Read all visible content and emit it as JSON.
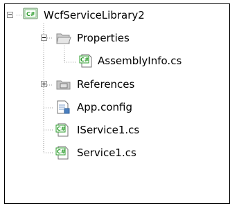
{
  "tree": {
    "nodes": [
      {
        "label": "WcfServiceLibrary2",
        "icon": "csharp-project-icon",
        "expanded": true
      },
      {
        "label": "Properties",
        "icon": "folder-icon",
        "expanded": true
      },
      {
        "label": "AssemblyInfo.cs",
        "icon": "csharp-file-icon"
      },
      {
        "label": "References",
        "icon": "references-icon",
        "expanded": false
      },
      {
        "label": "App.config",
        "icon": "config-file-icon"
      },
      {
        "label": "IService1.cs",
        "icon": "csharp-file-icon"
      },
      {
        "label": "Service1.cs",
        "icon": "csharp-file-icon"
      }
    ]
  },
  "colors": {
    "csharp_green": "#2e9e2e",
    "folder_gray": "#b8b8b8",
    "guide_dots": "#9a9a9a",
    "expander_border": "#8f8f8f"
  }
}
